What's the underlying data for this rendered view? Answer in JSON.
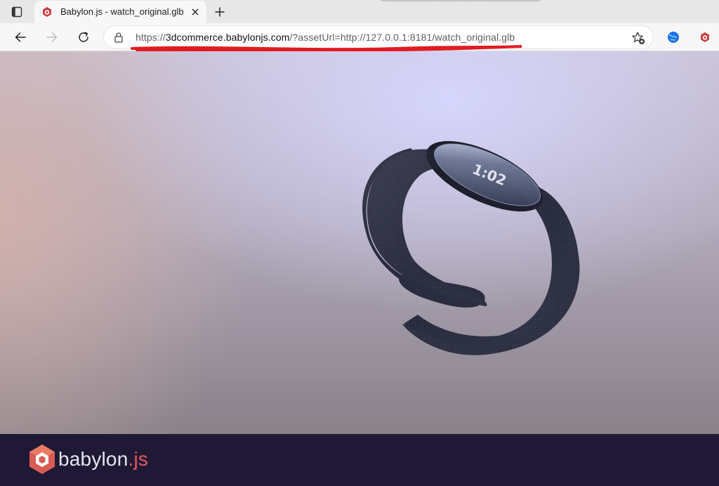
{
  "browser": {
    "tab": {
      "title": "Babylon.js - watch_original.glb",
      "favicon": "babylon-logo-icon"
    },
    "address_bar": {
      "url_protocol": "https://",
      "url_host": "3dcommerce.babylonjs.com",
      "url_rest": "/?assetUrl=http://127.0.0.1:8181/watch_original.glb"
    },
    "icons": {
      "tab_actions": "tab-actions-icon",
      "close": "close-icon",
      "new_tab": "plus-icon",
      "back": "back-arrow-icon",
      "forward": "forward-arrow-icon",
      "refresh": "refresh-icon",
      "lock": "lock-icon",
      "favorite": "star-add-icon",
      "extension_1": "globe-extension-icon",
      "extension_2": "babylon-extension-icon"
    },
    "annotation_color": "#e11b22"
  },
  "scene": {
    "model_file": "watch_original.glb",
    "watch_face_time": "1:02"
  },
  "footer": {
    "brand_name": "babylon",
    "brand_suffix": ".js",
    "background": "#201936",
    "accent": "#e2595b"
  }
}
